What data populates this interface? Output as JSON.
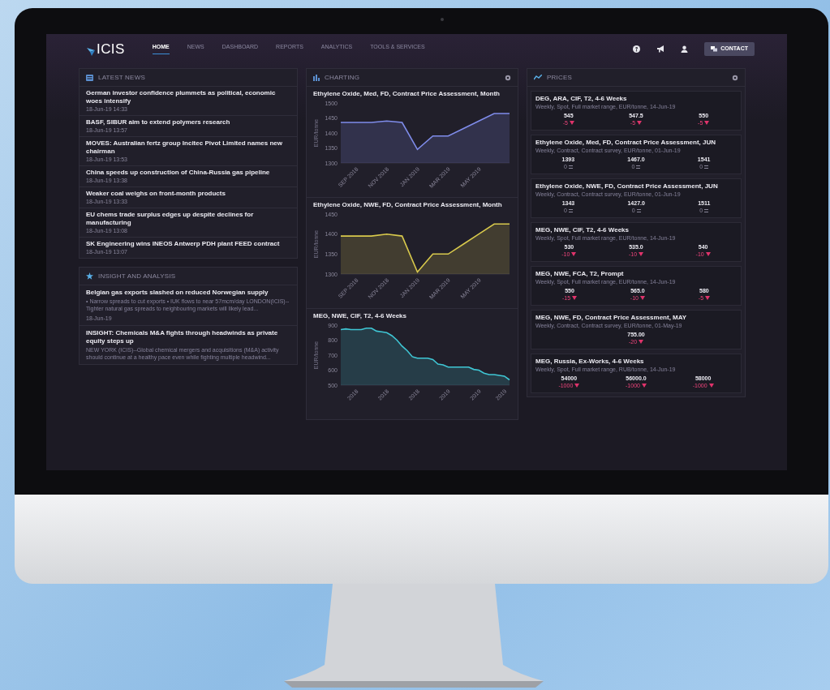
{
  "nav": {
    "logo": "ICIS",
    "items": [
      {
        "label": "HOME",
        "selected": true
      },
      {
        "label": "NEWS",
        "selected": false
      },
      {
        "label": "DASHBOARD",
        "selected": false
      },
      {
        "label": "REPORTS",
        "selected": false
      },
      {
        "label": "ANALYTICS",
        "selected": false
      },
      {
        "label": "TOOLS & SERVICES",
        "selected": false
      }
    ],
    "contact": "CONTACT"
  },
  "latest_news": {
    "title": "LATEST NEWS",
    "items": [
      {
        "title": "German investor confidence plummets as political, economic woes intensify",
        "time": "18-Jun-19 14:33"
      },
      {
        "title": "BASF, SIBUR aim to extend polymers research",
        "time": "18-Jun-19 13:57"
      },
      {
        "title": "MOVES: Australian fertz group Incitec Pivot Limited names new chairman",
        "time": "18-Jun-19 13:53"
      },
      {
        "title": "China speeds up construction of China-Russia gas pipeline",
        "time": "18-Jun-19 13:38"
      },
      {
        "title": "Weaker coal weighs on front-month products",
        "time": "18-Jun-19 13:33"
      },
      {
        "title": "EU chems trade surplus edges up despite declines for manufacturing",
        "time": "18-Jun-19 13:08"
      },
      {
        "title": "SK Engineering wins INEOS Antwerp PDH plant FEED contract",
        "time": "18-Jun-19 13:07"
      }
    ]
  },
  "insight": {
    "title": "INSIGHT AND ANALYSIS",
    "items": [
      {
        "title": "Belgian gas exports slashed on reduced Norwegian supply",
        "summary": "• Narrow spreads to cut exports • IUK flows to near 57mcm/day LONDON(ICIS)--Tighter natural gas spreads to neighbouring markets will likely lead...",
        "date": "18-Jun-19"
      },
      {
        "title": "INSIGHT: Chemicals M&A fights through headwinds as private equity steps up",
        "summary": "NEW YORK (ICIS)--Global chemical mergers and acquisitions (M&A) activity should continue at a healthy pace even while fighting multiple headwind..."
      }
    ]
  },
  "charting": {
    "title": "CHARTING",
    "charts": [
      {
        "title": "Ethylene Oxide, Med, FD, Contract Price Assessment, Month",
        "chart_data": {
          "type": "area",
          "ylabel": "EUR/tonne",
          "categories": [
            null,
            "SEP 2018",
            null,
            "NOV 2018",
            null,
            "JAN 2019",
            null,
            "MAR 2019",
            null,
            "MAY 2019",
            null,
            null
          ],
          "series": [
            {
              "color": "#7f8cea",
              "values": [
                1435,
                1435,
                1435,
                1440,
                1435,
                1345,
                1390,
                1390,
                1415,
                1440,
                1465,
                1465
              ]
            }
          ],
          "ylim": [
            1300,
            1500
          ],
          "yticks": [
            1300,
            1350,
            1400,
            1450,
            1500
          ]
        }
      },
      {
        "title": "Ethylene Oxide, NWE, FD, Contract Price Assessment, Month",
        "chart_data": {
          "type": "area",
          "ylabel": "EUR/tonne",
          "categories": [
            null,
            "SEP 2018",
            null,
            "NOV 2018",
            null,
            "JAN 2019",
            null,
            "MAR 2019",
            null,
            "MAY 2019",
            null,
            null
          ],
          "series": [
            {
              "color": "#d8c94c",
              "values": [
                1395,
                1395,
                1395,
                1400,
                1395,
                1305,
                1350,
                1350,
                1375,
                1400,
                1425,
                1425
              ]
            }
          ],
          "ylim": [
            1300,
            1450
          ],
          "yticks": [
            1300,
            1350,
            1400,
            1450
          ]
        }
      },
      {
        "title": "MEG, NWE, CIF, T2, 4-6 Weeks",
        "chart_data": {
          "type": "area",
          "ylabel": "EUR/tonne",
          "categories": [
            null,
            null,
            null,
            "2018",
            null,
            null,
            null,
            null,
            null,
            "2018",
            null,
            null,
            null,
            null,
            null,
            "2018",
            null,
            null,
            null,
            null,
            null,
            "2019",
            null,
            null,
            null,
            null,
            null,
            "2019",
            null,
            null,
            null,
            null,
            "2019",
            null
          ],
          "series": [
            {
              "color": "#3fc6d4",
              "values": [
                870,
                875,
                870,
                870,
                870,
                880,
                880,
                860,
                855,
                850,
                830,
                800,
                760,
                730,
                690,
                680,
                680,
                680,
                670,
                640,
                635,
                620,
                620,
                620,
                620,
                620,
                605,
                600,
                580,
                570,
                570,
                565,
                560,
                535
              ]
            }
          ],
          "ylim": [
            500,
            900
          ],
          "yticks": [
            500,
            600,
            700,
            800,
            900
          ]
        }
      }
    ]
  },
  "prices": {
    "title": "PRICES",
    "cards": [
      {
        "title": "DEG, ARA, CIF, T2, 4-6 Weeks",
        "subtitle": "Weekly, Spot, Full market range, EUR/tonne, 14-Jun-19",
        "values": [
          {
            "value": "545",
            "change": "-5",
            "kind": "down"
          },
          {
            "value": "547.5",
            "change": "-5",
            "kind": "down"
          },
          {
            "value": "550",
            "change": "-5",
            "kind": "down"
          }
        ]
      },
      {
        "title": "Ethylene Oxide, Med, FD, Contract Price Assessment, JUN",
        "subtitle": "Weekly, Contract, Contract survey, EUR/tonne, 01-Jun-19",
        "values": [
          {
            "value": "1393",
            "change": "0",
            "kind": "flat"
          },
          {
            "value": "1467.0",
            "change": "0",
            "kind": "flat"
          },
          {
            "value": "1541",
            "change": "0",
            "kind": "flat"
          }
        ]
      },
      {
        "title": "Ethylene Oxide, NWE, FD, Contract Price Assessment, JUN",
        "subtitle": "Weekly, Contract, Contract survey, EUR/tonne, 01-Jun-19",
        "values": [
          {
            "value": "1343",
            "change": "0",
            "kind": "flat"
          },
          {
            "value": "1427.0",
            "change": "0",
            "kind": "flat"
          },
          {
            "value": "1511",
            "change": "0",
            "kind": "flat"
          }
        ]
      },
      {
        "title": "MEG, NWE, CIF, T2, 4-6 Weeks",
        "subtitle": "Weekly, Spot, Full market range, EUR/tonne, 14-Jun-19",
        "values": [
          {
            "value": "530",
            "change": "-10",
            "kind": "down"
          },
          {
            "value": "535.0",
            "change": "-10",
            "kind": "down"
          },
          {
            "value": "540",
            "change": "-10",
            "kind": "down"
          }
        ]
      },
      {
        "title": "MEG, NWE, FCA, T2, Prompt",
        "subtitle": "Weekly, Spot, Full market range, EUR/tonne, 14-Jun-19",
        "values": [
          {
            "value": "550",
            "change": "-15",
            "kind": "down"
          },
          {
            "value": "565.0",
            "change": "-10",
            "kind": "down"
          },
          {
            "value": "580",
            "change": "-5",
            "kind": "down"
          }
        ]
      },
      {
        "title": "MEG, NWE, FD, Contract Price Assessment, MAY",
        "subtitle": "Weekly, Contract, Contract survey, EUR/tonne, 01-May-19",
        "values": [
          {
            "value": "755.00",
            "change": "-20",
            "kind": "down"
          }
        ]
      },
      {
        "title": "MEG, Russia, Ex-Works, 4-6 Weeks",
        "subtitle": "Weekly, Spot, Full market range, RUB/tonne, 14-Jun-19",
        "values": [
          {
            "value": "54000",
            "change": "-1000",
            "kind": "down"
          },
          {
            "value": "56000.0",
            "change": "-1000",
            "kind": "down"
          },
          {
            "value": "58000",
            "change": "-1000",
            "kind": "down"
          }
        ]
      }
    ]
  }
}
